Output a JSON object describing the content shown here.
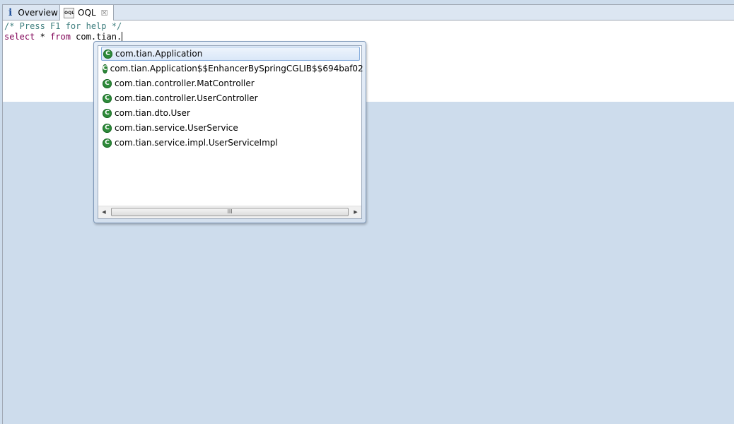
{
  "tabs": [
    {
      "label": "Overview",
      "icon": "info-icon"
    },
    {
      "label": "OQL",
      "icon": "oql-icon",
      "icon_text": "OQL",
      "active": true,
      "closable": true
    }
  ],
  "editor": {
    "comment": "/* Press F1 for help */",
    "line2_keyword1": "select",
    "line2_star": " * ",
    "line2_keyword2": "from",
    "line2_text": " com.tian."
  },
  "autocomplete": {
    "selected_index": 0,
    "items": [
      "com.tian.Application",
      "com.tian.Application$$EnhancerBySpringCGLIB$$694baf02",
      "com.tian.controller.MatController",
      "com.tian.controller.UserController",
      "com.tian.dto.User",
      "com.tian.service.UserService",
      "com.tian.service.impl.UserServiceImpl"
    ],
    "item_icon": "class-icon",
    "item_icon_text": "C"
  },
  "colors": {
    "background": "#cddcec",
    "comment": "#3f7f7f",
    "keyword": "#7f0055",
    "class_icon": "#2e8b3a"
  }
}
